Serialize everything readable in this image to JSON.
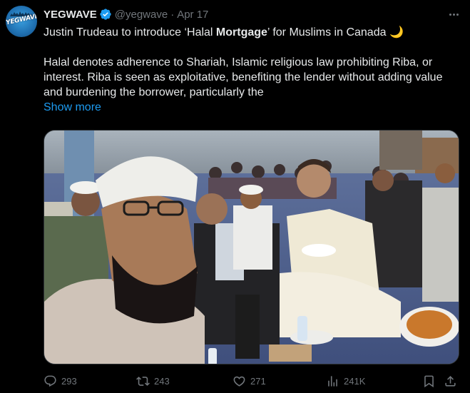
{
  "author": {
    "name": "YEGWAVE",
    "handle": "@yegwave",
    "separator": "·",
    "date": "Apr 17",
    "avatar_logo_text": "YEGWAVE"
  },
  "tweet": {
    "line1_before": "Justin Trudeau to introduce ‘Halal ",
    "line1_bold": "Mortgage",
    "line1_after": "’ for Muslims in Canada ",
    "line1_emoji": "🌙",
    "body": "Halal denotes adherence to Shariah, Islamic religious law prohibiting Riba, or interest. Riba is seen as exploitative, benefiting the lender without adding value and burdening the borrower, particularly the",
    "show_more": "Show more"
  },
  "actions": {
    "replies": "293",
    "reposts": "243",
    "likes": "271",
    "views": "241K"
  },
  "colors": {
    "background": "#000000",
    "text": "#e7e9ea",
    "muted": "#71767b",
    "link": "#1d9bf0",
    "verified": "#1d9bf0"
  },
  "icons": [
    "verified-badge-icon",
    "more-options-icon",
    "reply-icon",
    "repost-icon",
    "like-icon",
    "views-icon",
    "bookmark-icon",
    "share-icon"
  ]
}
